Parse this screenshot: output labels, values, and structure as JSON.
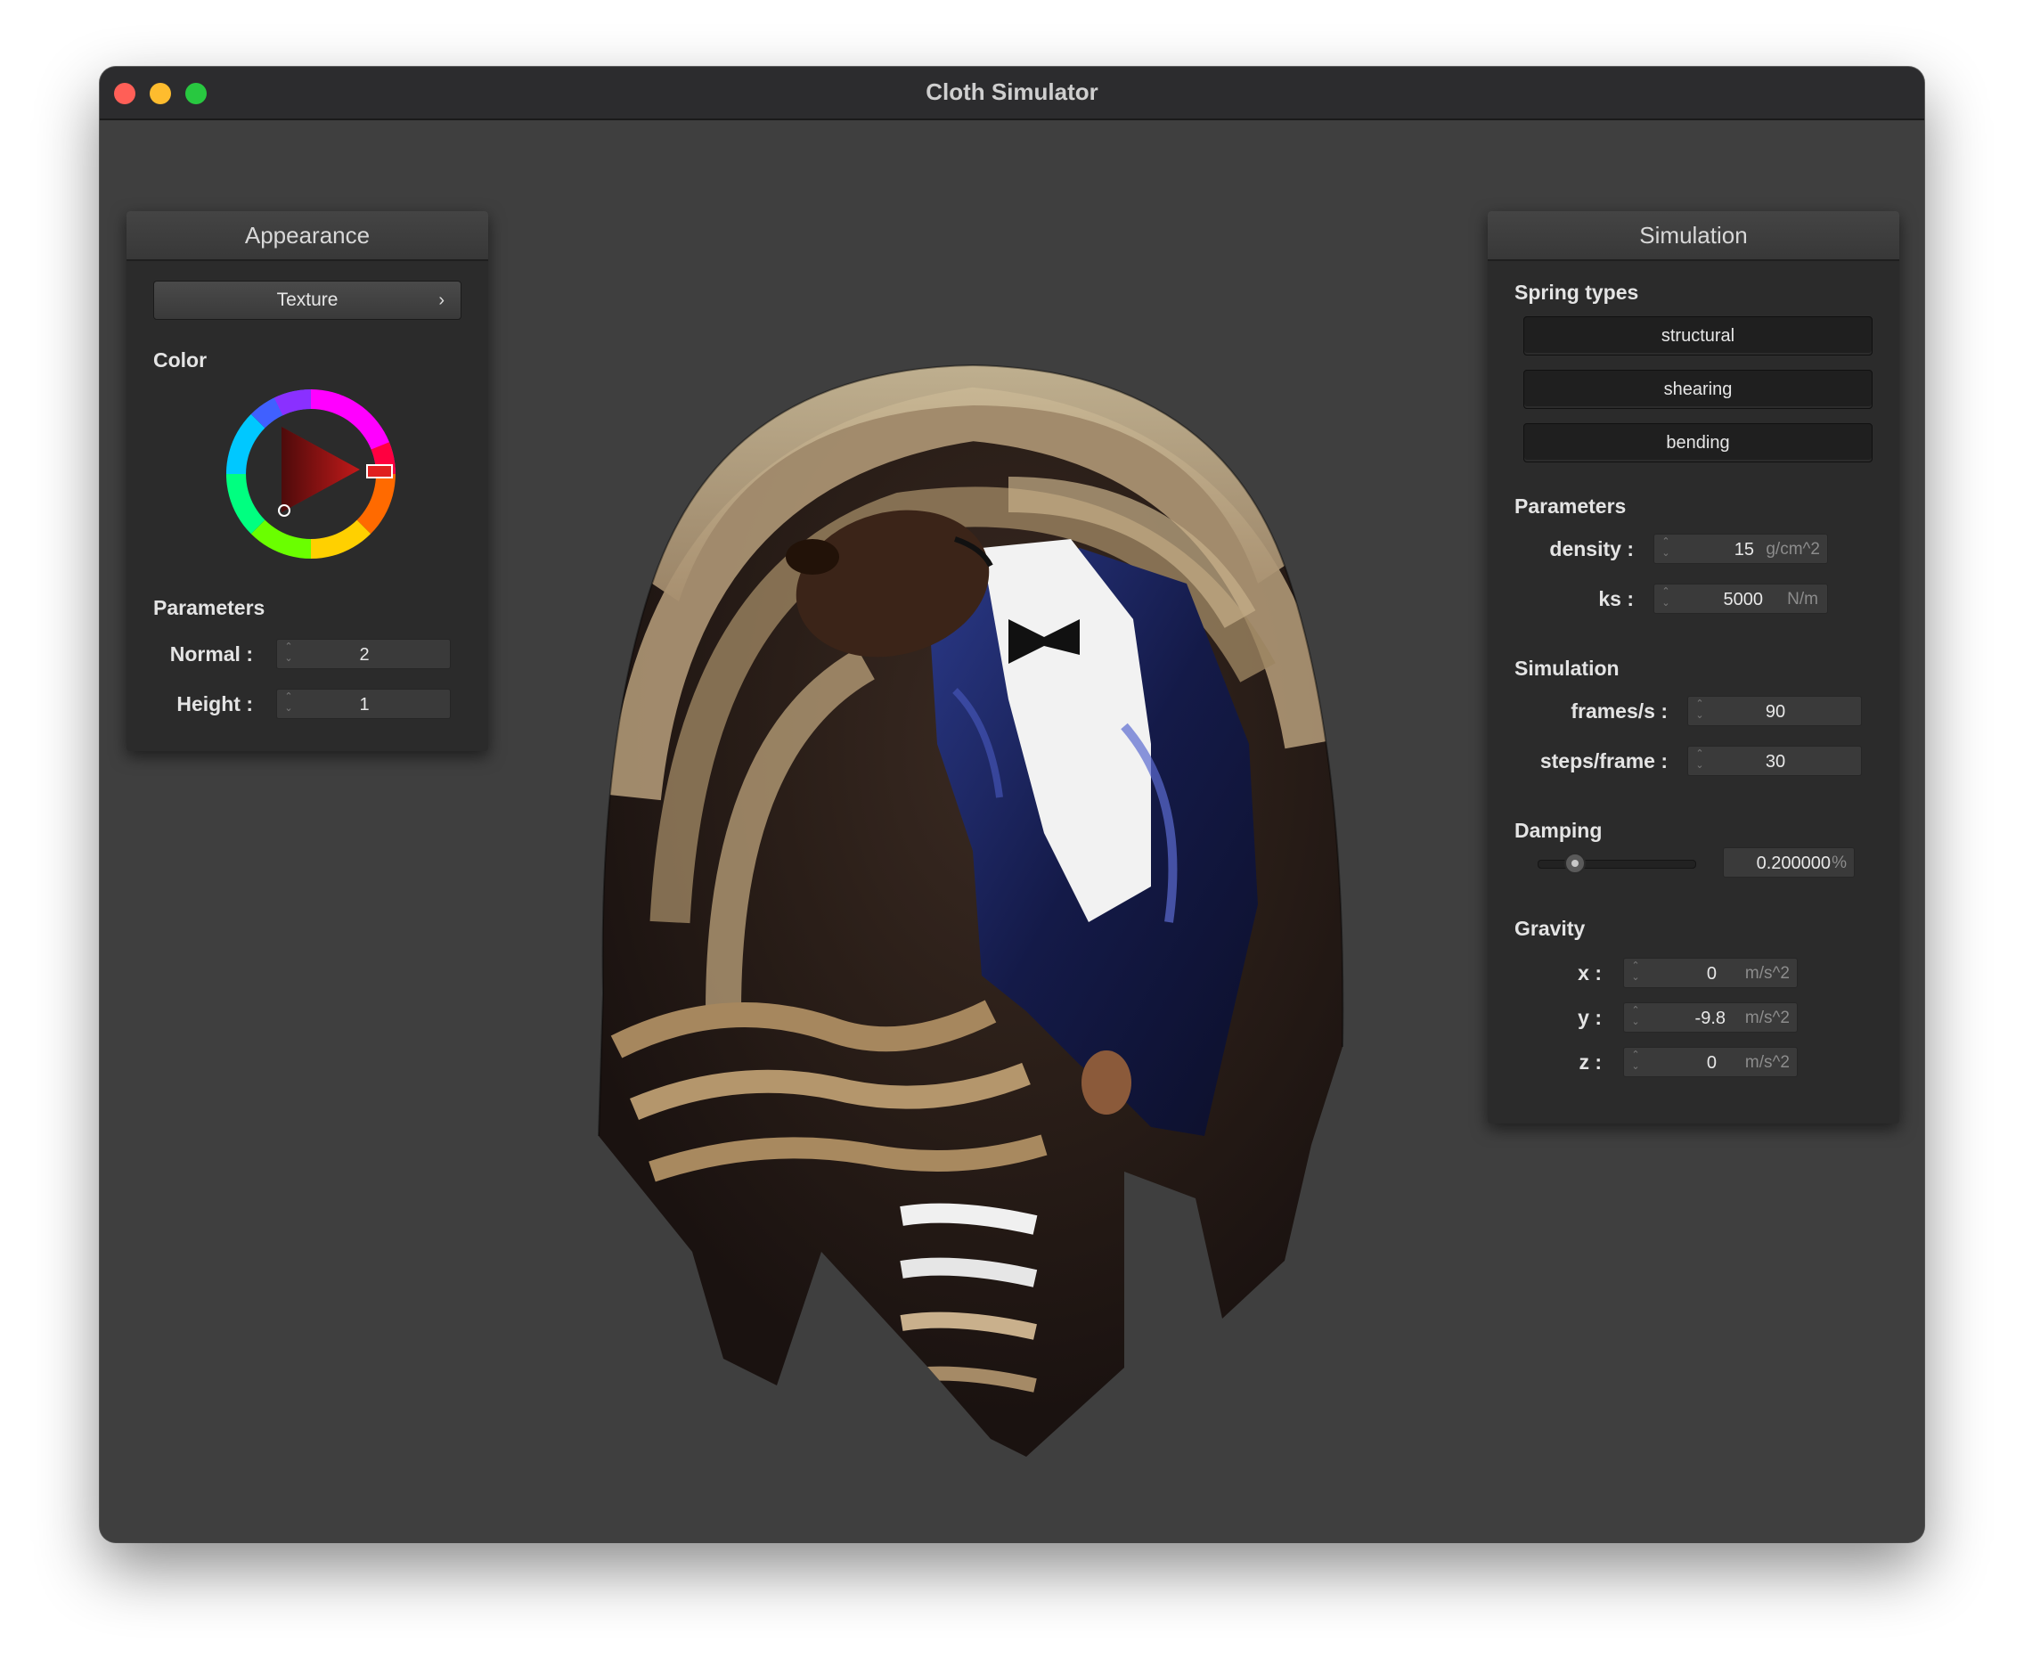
{
  "window": {
    "title": "Cloth Simulator"
  },
  "appearance": {
    "header": "Appearance",
    "texture_button": "Texture",
    "color_label": "Color",
    "parameters_label": "Parameters",
    "normal_label": "Normal :",
    "normal_value": "2",
    "height_label": "Height :",
    "height_value": "1",
    "selected_hue": "#ff2020"
  },
  "simulation": {
    "header": "Simulation",
    "spring_types_label": "Spring types",
    "spring_types": [
      "structural",
      "shearing",
      "bending"
    ],
    "parameters_label": "Parameters",
    "density_label": "density :",
    "density_value": "15",
    "density_unit": "g/cm^2",
    "ks_label": "ks :",
    "ks_value": "5000",
    "ks_unit": "N/m",
    "simulation_label": "Simulation",
    "fps_label": "frames/s :",
    "fps_value": "90",
    "steps_label": "steps/frame :",
    "steps_value": "30",
    "damping_label": "Damping",
    "damping_value": "0.200000",
    "damping_unit": "%",
    "damping_fraction": 0.2,
    "gravity_label": "Gravity",
    "gx_label": "x :",
    "gx_value": "0",
    "gy_label": "y :",
    "gy_value": "-9.8",
    "gz_label": "z :",
    "gz_value": "0",
    "g_unit": "m/s^2"
  }
}
